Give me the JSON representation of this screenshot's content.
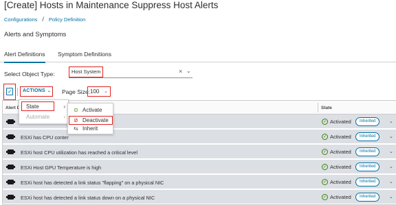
{
  "page": {
    "title": "[Create] Hosts in Maintenance Suppress Host Alerts",
    "breadcrumb": {
      "root": "Configurations",
      "separator": "/",
      "current": "Policy Definition"
    },
    "section_title": "Alerts and Symptoms"
  },
  "tabs": [
    {
      "label": "Alert Definitions",
      "active": true
    },
    {
      "label": "Symptom Definitions",
      "active": false
    }
  ],
  "object_type": {
    "label": "Select Object Type:",
    "value": "Host System",
    "clear_glyph": "×",
    "chevron_glyph": "⌄"
  },
  "toolbar": {
    "actions_label": "ACTIONS",
    "actions_caret": "⌄",
    "page_size_label": "Page Size:",
    "page_size_value": "100",
    "page_size_chevron": "⌄"
  },
  "grid": {
    "columns": {
      "alert": "Alert D",
      "state": "State"
    },
    "rows": [
      {
        "name": "E",
        "state": "Activated",
        "badge": "Inherited"
      },
      {
        "name": "ESXi has CPU conter",
        "state": "Activated",
        "badge": "Inherited"
      },
      {
        "name": "ESXi host CPU utilization has reached a critical level",
        "state": "Activated",
        "badge": "Inherited"
      },
      {
        "name": "ESXi Host GPU Temperature is high",
        "state": "Activated",
        "badge": "Inherited"
      },
      {
        "name": "ESXi host has detected a link status \"flapping\" on a physical NIC",
        "state": "Activated",
        "badge": "Inherited"
      },
      {
        "name": "ESXi host has detected a link status down on a physical NIC",
        "state": "Activated",
        "badge": "Inherited"
      }
    ]
  },
  "actions_menu": {
    "items": [
      {
        "label": "State",
        "arrow": "›",
        "enabled": true
      },
      {
        "label": "Automate",
        "arrow": "›",
        "enabled": false
      }
    ]
  },
  "state_submenu": {
    "items": [
      {
        "label": "Activate",
        "icon": "check-circle-icon",
        "glyph": "⊘"
      },
      {
        "label": "Deactivate",
        "icon": "ban-icon",
        "glyph": "⊘"
      },
      {
        "label": "Inherit",
        "icon": "inherit-icon",
        "glyph": "⇆"
      }
    ]
  },
  "colors": {
    "accent": "#0072a3",
    "highlight": "#e02020",
    "success": "#3c8500",
    "row_bg": "#dcdfe4"
  }
}
